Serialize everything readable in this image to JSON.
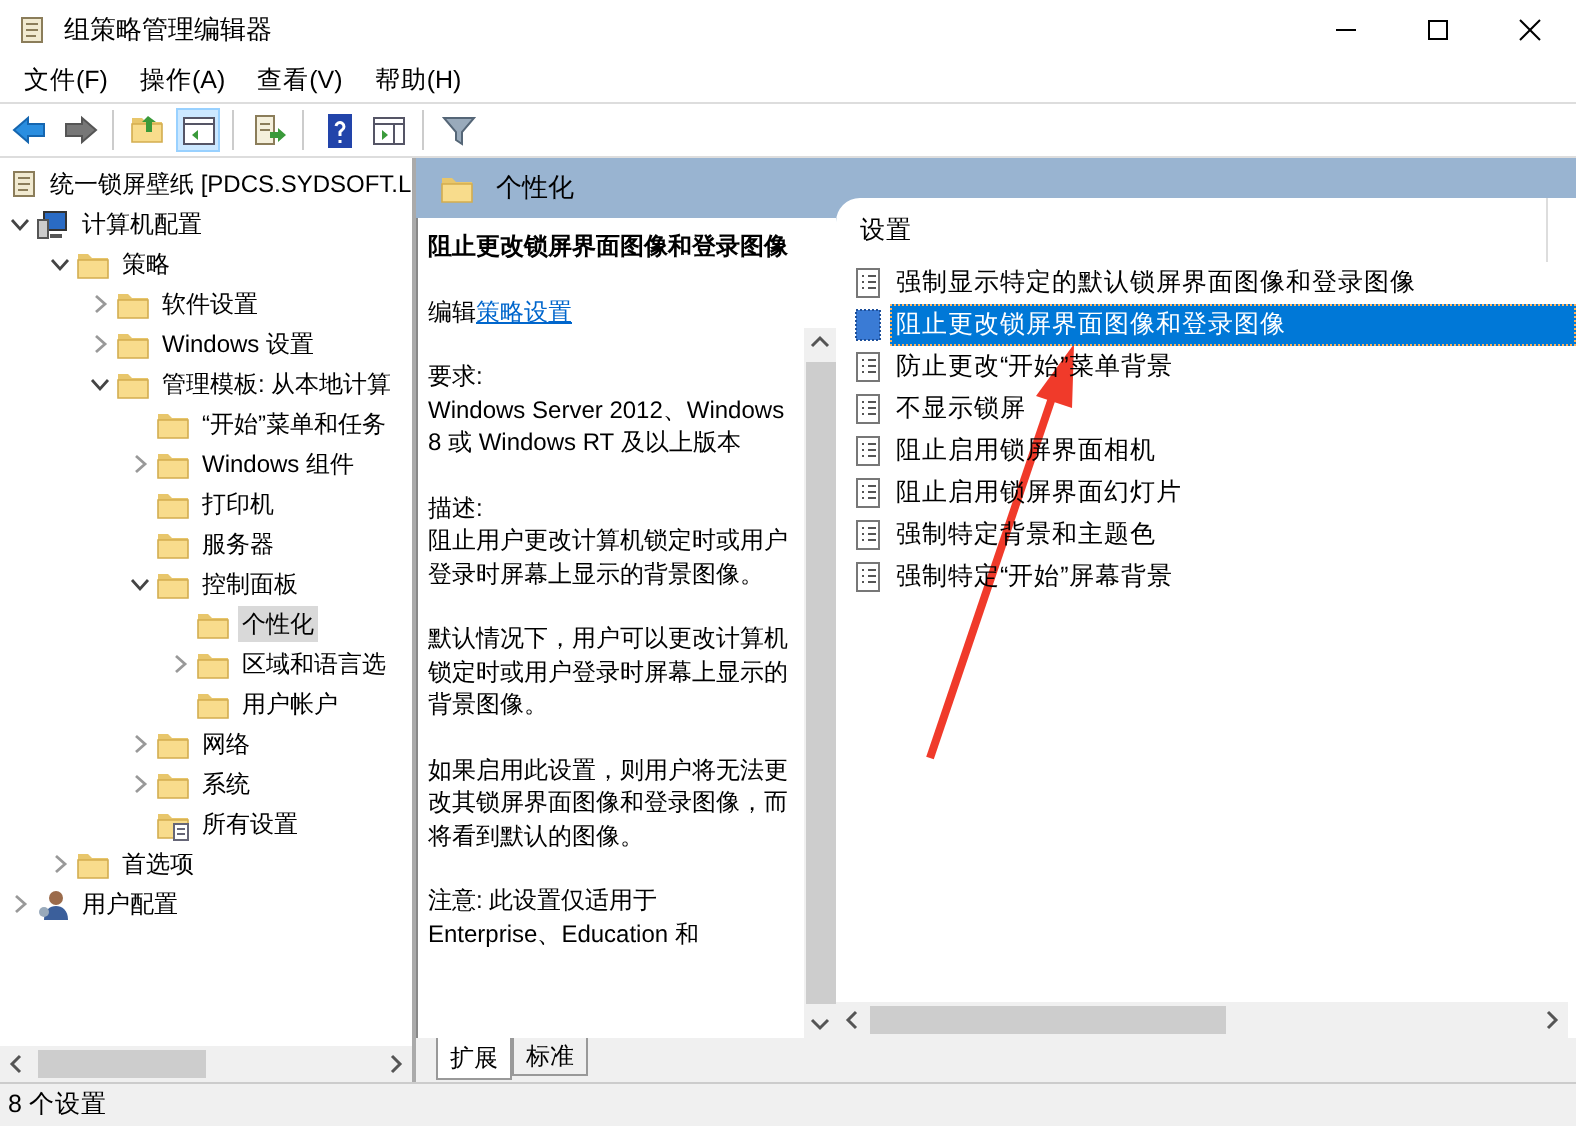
{
  "window": {
    "title": "组策略管理编辑器"
  },
  "menu": [
    "文件(F)",
    "操作(A)",
    "查看(V)",
    "帮助(H)"
  ],
  "toolbar": [
    {
      "kind": "back",
      "selected": false
    },
    {
      "kind": "forward",
      "selected": false
    },
    {
      "kind": "sep"
    },
    {
      "kind": "up",
      "selected": false
    },
    {
      "kind": "tree-toggle",
      "selected": true
    },
    {
      "kind": "sep"
    },
    {
      "kind": "export",
      "selected": false
    },
    {
      "kind": "sep"
    },
    {
      "kind": "help",
      "selected": false
    },
    {
      "kind": "action-pane",
      "selected": false
    },
    {
      "kind": "sep"
    },
    {
      "kind": "filter",
      "selected": false
    }
  ],
  "tree": {
    "root": "统一锁屏壁纸 [PDCS.SYDSOFT.L",
    "children": [
      {
        "label": "计算机配置",
        "kind": "computer",
        "expanded": true,
        "selected": false,
        "children": [
          {
            "label": "策略",
            "kind": "folder",
            "expanded": true,
            "selected": false,
            "children": [
              {
                "label": "软件设置",
                "kind": "folder",
                "expanded": false,
                "selected": false
              },
              {
                "label": "Windows 设置",
                "kind": "folder",
                "expanded": false,
                "selected": false
              },
              {
                "label": "管理模板: 从本地计算",
                "kind": "folder",
                "expanded": true,
                "selected": false,
                "children": [
                  {
                    "label": "“开始”菜单和任务",
                    "kind": "folder",
                    "selected": false
                  },
                  {
                    "label": "Windows 组件",
                    "kind": "folder",
                    "expanded": false,
                    "selected": false
                  },
                  {
                    "label": "打印机",
                    "kind": "folder",
                    "selected": false
                  },
                  {
                    "label": "服务器",
                    "kind": "folder",
                    "selected": false
                  },
                  {
                    "label": "控制面板",
                    "kind": "folder",
                    "expanded": true,
                    "selected": false,
                    "children": [
                      {
                        "label": "个性化",
                        "kind": "folder",
                        "selected": true
                      },
                      {
                        "label": "区域和语言选",
                        "kind": "folder",
                        "expanded": false,
                        "selected": false
                      },
                      {
                        "label": "用户帐户",
                        "kind": "folder",
                        "selected": false
                      }
                    ]
                  },
                  {
                    "label": "网络",
                    "kind": "folder",
                    "expanded": false,
                    "selected": false
                  },
                  {
                    "label": "系统",
                    "kind": "folder",
                    "expanded": false,
                    "selected": false
                  },
                  {
                    "label": "所有设置",
                    "kind": "all-settings",
                    "selected": false
                  }
                ]
              }
            ]
          },
          {
            "label": "首选项",
            "kind": "folder",
            "expanded": false,
            "selected": false
          }
        ]
      },
      {
        "label": "用户配置",
        "kind": "user",
        "expanded": false,
        "selected": false
      }
    ]
  },
  "header": {
    "title": "个性化"
  },
  "description": {
    "title": "阻止更改锁屏界面图像和登录图像",
    "edit_prefix": "编辑",
    "edit_link": "策略设置",
    "paragraphs": [
      [
        "要求:",
        "Windows Server 2012、Windows 8 或 Windows RT 及以上版本"
      ],
      [
        "描述:",
        "阻止用户更改计算机锁定时或用户登录时屏幕上显示的背景图像。"
      ],
      [
        "默认情况下，用户可以更改计算机锁定时或用户登录时屏幕上显示的背景图像。"
      ],
      [
        "如果启用此设置，则用户将无法更改其锁屏界面图像和登录图像，而将看到默认的图像。"
      ],
      [
        "注意: 此设置仅适用于",
        "Enterprise、Education 和"
      ]
    ]
  },
  "settings": {
    "column": "设置",
    "items": [
      {
        "label": "强制显示特定的默认锁屏界面图像和登录图像",
        "selected": false
      },
      {
        "label": "阻止更改锁屏界面图像和登录图像",
        "selected": true
      },
      {
        "label": "防止更改“开始”菜单背景",
        "selected": false
      },
      {
        "label": "不显示锁屏",
        "selected": false
      },
      {
        "label": "阻止启用锁屏界面相机",
        "selected": false
      },
      {
        "label": "阻止启用锁屏界面幻灯片",
        "selected": false
      },
      {
        "label": "强制特定背景和主题色",
        "selected": false
      },
      {
        "label": "强制特定“开始”屏幕背景",
        "selected": false
      }
    ]
  },
  "tabs": [
    {
      "label": "扩展",
      "selected": true
    },
    {
      "label": "标准",
      "selected": false
    }
  ],
  "status_bar": "8 个设置"
}
